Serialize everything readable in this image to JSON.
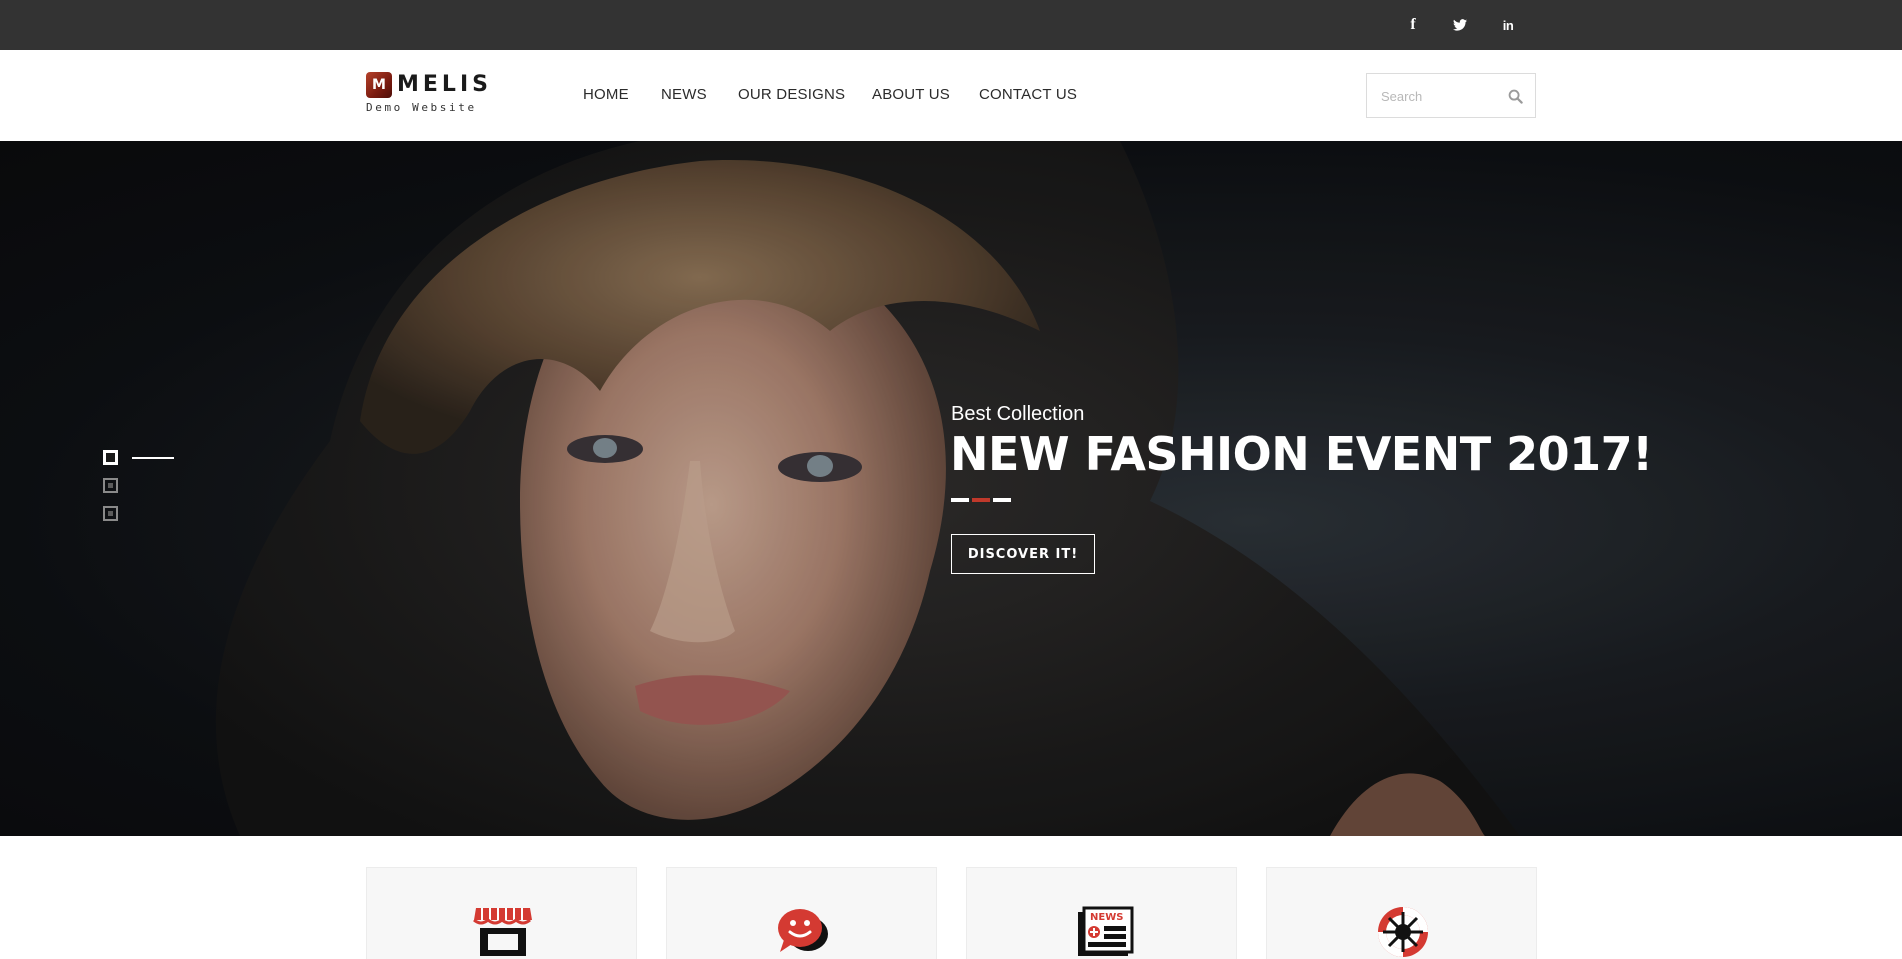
{
  "topbar": {
    "social": [
      {
        "name": "facebook",
        "glyph": "f"
      },
      {
        "name": "twitter",
        "glyph": "twitter-bird"
      },
      {
        "name": "linkedin",
        "glyph": "in"
      }
    ]
  },
  "header": {
    "logo": {
      "mark": "M",
      "title": "MELIS",
      "subtitle": "Demo Website"
    },
    "nav": [
      {
        "label": "HOME"
      },
      {
        "label": "NEWS"
      },
      {
        "label": "OUR DESIGNS"
      },
      {
        "label": "ABOUT US"
      },
      {
        "label": "CONTACT US"
      }
    ],
    "search": {
      "placeholder": "Search",
      "value": ""
    }
  },
  "hero": {
    "subtitle": "Best Collection",
    "title": "NEW FASHION EVENT 2017!",
    "button_label": "DISCOVER IT!",
    "slides_total": 3,
    "active_slide": 1
  },
  "cards": [
    {
      "icon": "shop-awning-icon"
    },
    {
      "icon": "chat-bubble-icon"
    },
    {
      "icon": "newspaper-icon"
    },
    {
      "icon": "lifebuoy-icon"
    }
  ],
  "colors": {
    "topbar": "#333333",
    "accent": "#c0392b",
    "text_dark": "#2b2b2b",
    "logo_brown": "#7a1b10"
  }
}
